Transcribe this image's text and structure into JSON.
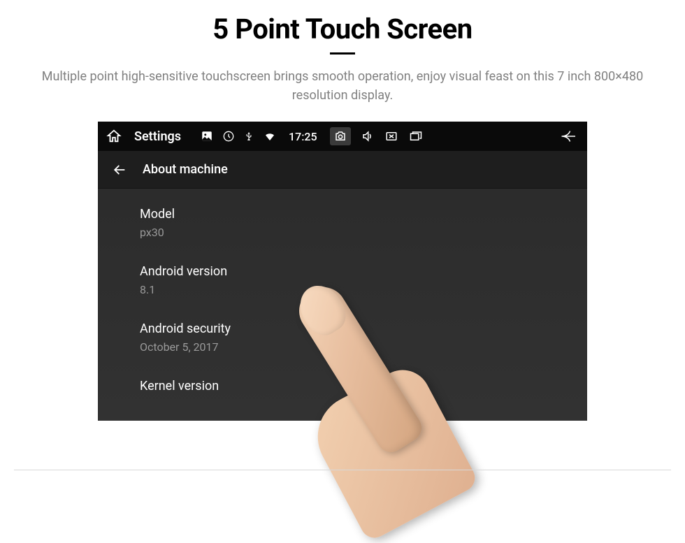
{
  "heading": "5 Point Touch Screen",
  "subtitle": "Multiple point high-sensitive touchscreen brings smooth operation, enjoy visual feast on this 7 inch 800×480 resolution display.",
  "statusbar": {
    "app_label": "Settings",
    "time": "17:25"
  },
  "page": {
    "title": "About machine"
  },
  "settings": [
    {
      "label": "Model",
      "value": "px30"
    },
    {
      "label": "Android version",
      "value": "8.1"
    },
    {
      "label": "Android security",
      "value": "October 5, 2017"
    },
    {
      "label": "Kernel version",
      "value": ""
    }
  ]
}
